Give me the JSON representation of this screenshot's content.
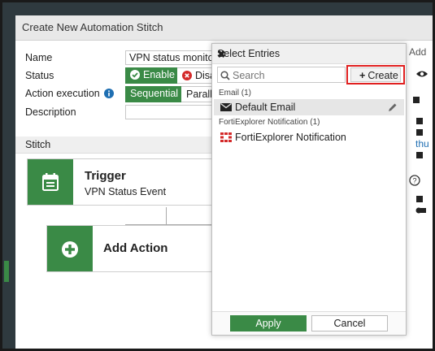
{
  "dialog": {
    "title": "Create New Automation Stitch"
  },
  "form": {
    "name_label": "Name",
    "name_value": "VPN status monitor",
    "status_label": "Status",
    "enable_label": "Enable",
    "disable_label": "Disa",
    "action_exec_label": "Action execution",
    "sequential_label": "Sequential",
    "parallel_label": "Paralle",
    "description_label": "Description"
  },
  "stitch": {
    "section_label": "Stitch",
    "trigger_title": "Trigger",
    "trigger_subtitle": "VPN Status Event",
    "add_action_label": "Add Action"
  },
  "panel": {
    "title": "Select Entries",
    "search_placeholder": "Search",
    "create_label": "Create",
    "groups": [
      {
        "label": "Email (1)",
        "items": [
          {
            "label": "Default Email",
            "icon": "envelope-icon"
          }
        ]
      },
      {
        "label": "FortiExplorer Notification (1)",
        "items": [
          {
            "label": "FortiExplorer Notification",
            "icon": "fortiexplorer-icon"
          }
        ]
      }
    ],
    "apply_label": "Apply",
    "cancel_label": "Cancel"
  },
  "right_partial": {
    "add_label": "Add",
    "link_text": "thu"
  },
  "colors": {
    "accent_green": "#3a8a46",
    "highlight_red": "#e02020",
    "icon_red": "#d42a2a"
  }
}
